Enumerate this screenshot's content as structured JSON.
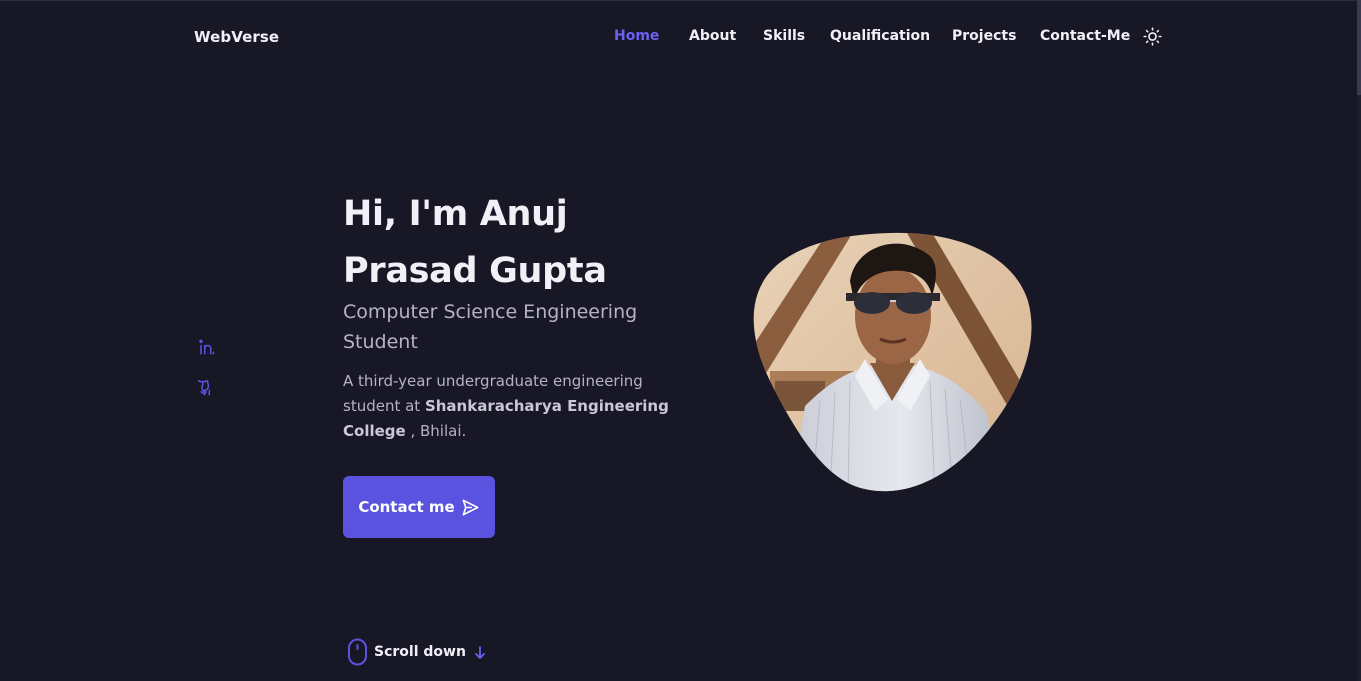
{
  "header": {
    "brand": "WebVerse",
    "nav": [
      {
        "label": "Home",
        "active": true
      },
      {
        "label": "About",
        "active": false
      },
      {
        "label": "Skills",
        "active": false
      },
      {
        "label": "Qualification",
        "active": false
      },
      {
        "label": "Projects",
        "active": false
      },
      {
        "label": "Contact-Me",
        "active": false
      }
    ],
    "theme_icon": "sun-icon"
  },
  "social": [
    {
      "name": "linkedin-icon"
    },
    {
      "name": "github-icon"
    }
  ],
  "hero": {
    "title_line1": "Hi, I'm Anuj",
    "title_line2": "Prasad Gupta",
    "subtitle": "Computer Science Engineering Student",
    "desc_prefix": "A third-year undergraduate engineering student at ",
    "desc_bold": "Shankaracharya Engineering College",
    "desc_suffix": " , Bhilai.",
    "button_label": "Contact me",
    "button_icon": "send-icon"
  },
  "scroll": {
    "label": "Scroll down",
    "icon": "mouse-icon",
    "arrow_icon": "arrow-down-icon"
  },
  "colors": {
    "background": "#181726",
    "accent": "#5a53e0",
    "active_nav": "#6b63f0",
    "text": "#f1f0f7",
    "muted": "#b4b3c5"
  }
}
